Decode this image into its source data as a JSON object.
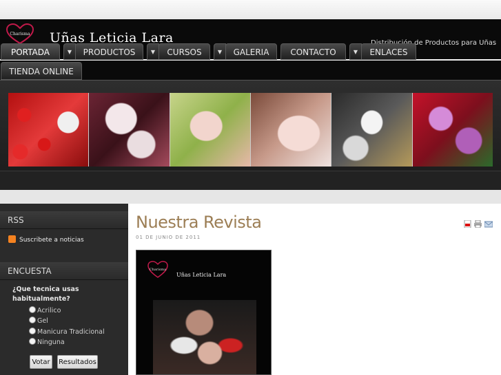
{
  "header": {
    "site_title": "Uñas Leticia Lara",
    "tagline": "Distribución de Productos para Uñas",
    "logo_text": "Charisma"
  },
  "nav": {
    "items": [
      {
        "label": "PORTADA",
        "active": true
      },
      {
        "label": "PRODUCTOS"
      },
      {
        "label": "CURSOS"
      },
      {
        "label": "GALERIA"
      },
      {
        "label": "CONTACTO"
      },
      {
        "label": "ENLACES"
      },
      {
        "label": "TIENDA ONLINE"
      }
    ]
  },
  "sidebar": {
    "rss_title": "RSS",
    "rss_link": "Suscribete a noticias",
    "poll_title": "ENCUESTA",
    "poll_question": "¿Que tecnica usas habitualmente?",
    "poll_options": [
      "Acrilico",
      "Gel",
      "Manicura Tradicional",
      "Ninguna"
    ],
    "vote_button": "Votar",
    "results_button": "Resultados"
  },
  "article": {
    "title": "Nuestra Revista",
    "date": "01 DE JUNIO DE 2011",
    "cover_title": "Uñas Leticia Lara",
    "cover_logo_text": "Charisma"
  },
  "colors": {
    "header_bg": "#0a0a0a",
    "title_color": "#9c7e55",
    "sidebar_bg": "#2b2b2b"
  }
}
